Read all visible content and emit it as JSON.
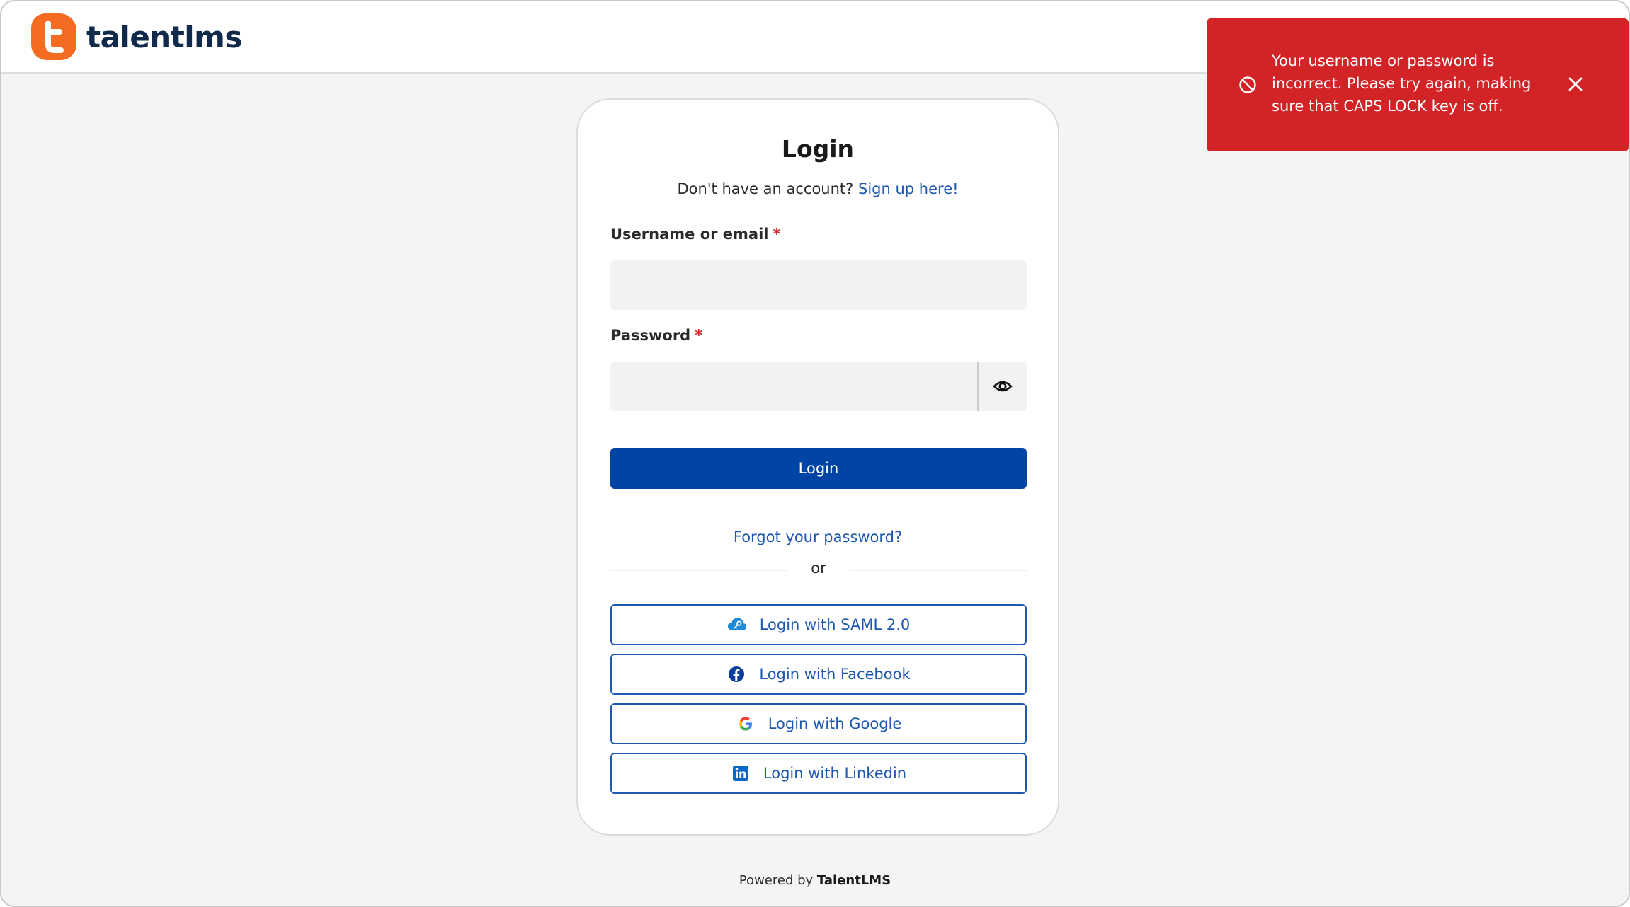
{
  "brand": {
    "name": "talentlms",
    "accent": "#f36c21",
    "primary": "#0045a6",
    "link": "#1d58b3",
    "error": "#d22327"
  },
  "toast": {
    "message": "Your username or password is incorrect. Please try again, making sure that CAPS LOCK key is off.",
    "icon": "block-icon",
    "close_icon": "close-icon"
  },
  "login": {
    "title": "Login",
    "signup_prompt": "Don't have an account?",
    "signup_link": "Sign up here!",
    "username_label": "Username or email",
    "password_label": "Password",
    "required_mark": "*",
    "username_value": "",
    "password_value": "",
    "show_password_icon": "eye-icon",
    "submit_label": "Login",
    "forgot_link": "Forgot your password?",
    "divider_text": "or",
    "sso": [
      {
        "label": "Login with SAML 2.0",
        "icon": "saml-cloud-icon"
      },
      {
        "label": "Login with Facebook",
        "icon": "facebook-icon"
      },
      {
        "label": "Login with Google",
        "icon": "google-icon"
      },
      {
        "label": "Login with Linkedin",
        "icon": "linkedin-icon"
      }
    ]
  },
  "footer": {
    "powered_prefix": "Powered by",
    "powered_brand": "TalentLMS"
  }
}
